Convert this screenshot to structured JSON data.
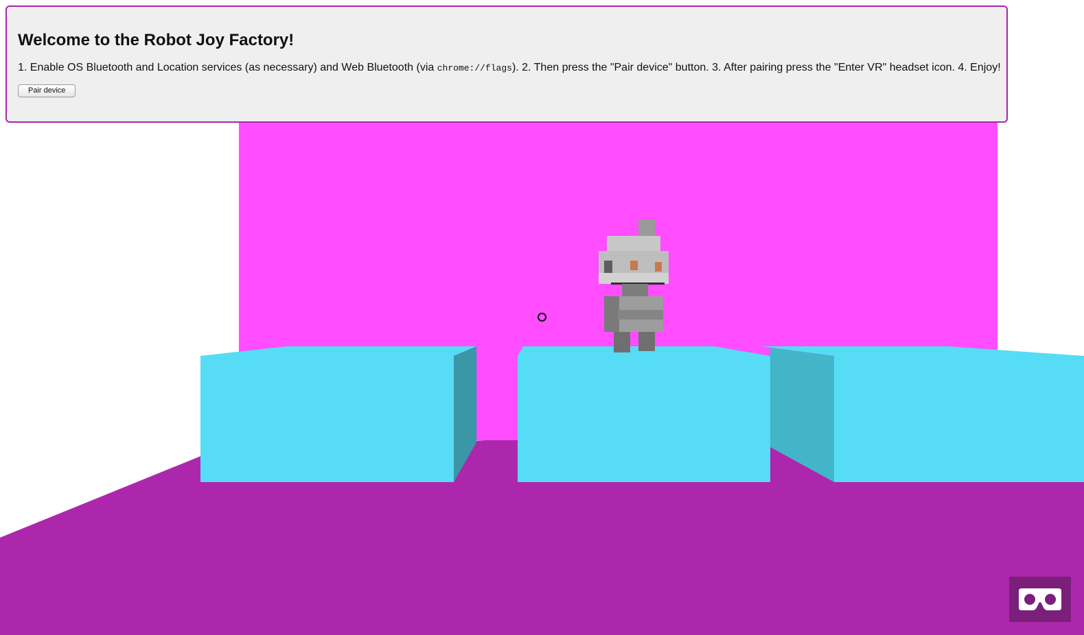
{
  "panel": {
    "title": "Welcome to the Robot Joy Factory!",
    "instructions_before_code": "1. Enable OS Bluetooth and Location services (as necessary) and Web Bluetooth (via ",
    "instructions_code": "chrome://flags",
    "instructions_after_code": "). 2. Then press the \"Pair device\" button. 3. After pairing press the \"Enter VR\" headset icon. 4. Enjoy!",
    "pair_button_label": "Pair device"
  },
  "vr_button": {
    "icon": "vr-headset-icon",
    "title": "Enter VR"
  },
  "scene": {
    "wall_color": "#ff4dff",
    "floor_color": "#ad27ad",
    "block_color": "#56dcf5",
    "block_side_color": "#3a97a8",
    "robot_color": "#a9a9a9"
  }
}
